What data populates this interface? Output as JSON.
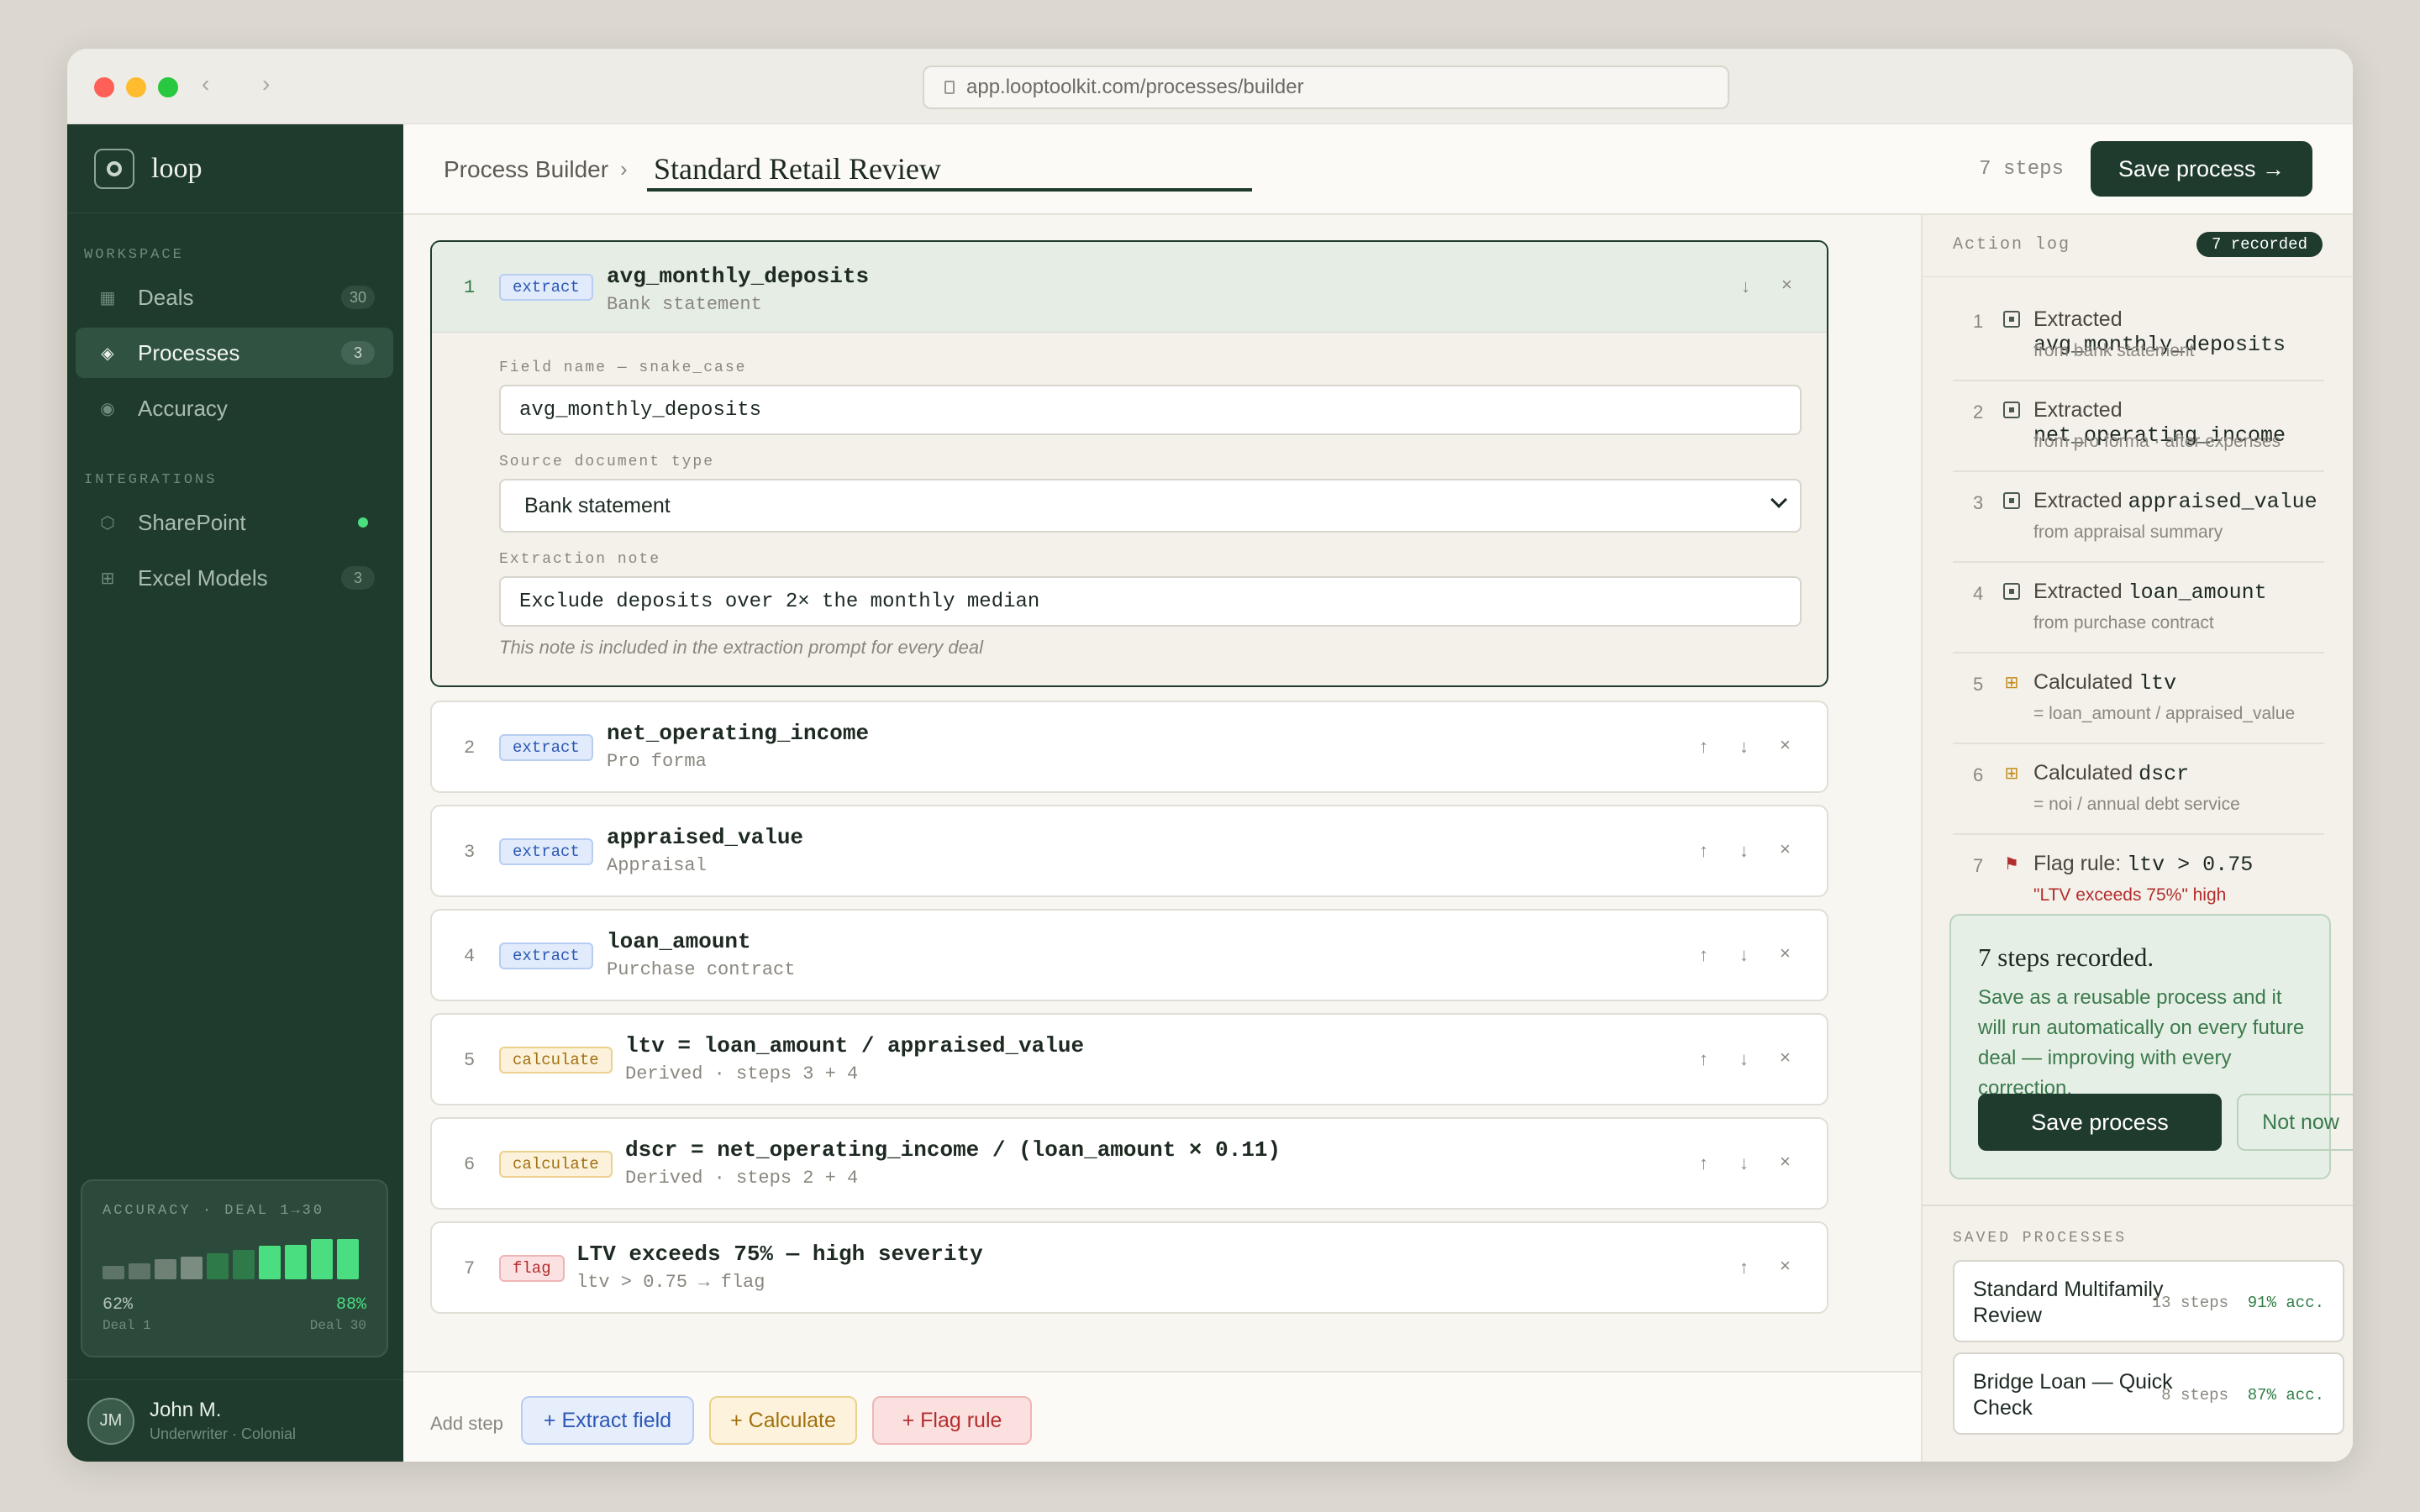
{
  "browser": {
    "url": "app.looptoolkit.com/processes/builder",
    "back_glyph": "‹",
    "forward_glyph": "›"
  },
  "sidebar": {
    "brand": "loop",
    "workspace_label": "WORKSPACE",
    "integrations_label": "INTEGRATIONS",
    "items": [
      {
        "label": "Deals",
        "badge": "30",
        "icon": "grid-icon",
        "glyph": "▦"
      },
      {
        "label": "Processes",
        "badge": "3",
        "icon": "diamond-icon",
        "glyph": "◈"
      },
      {
        "label": "Accuracy",
        "icon": "target-icon",
        "glyph": "◉"
      }
    ],
    "integrations": [
      {
        "label": "SharePoint",
        "icon": "hexagon-icon",
        "glyph": "⬡",
        "status": "connected"
      },
      {
        "label": "Excel Models",
        "badge": "3",
        "icon": "table-icon",
        "glyph": "⊞"
      }
    ],
    "accuracy": {
      "title": "ACCURACY · DEAL 1→30",
      "start_value": "62%",
      "end_value": "88%",
      "start_label": "Deal 1",
      "end_label": "Deal 30",
      "bar_levels": [
        0.28,
        0.34,
        0.42,
        0.48,
        0.56,
        0.62,
        0.72,
        0.74,
        0.86,
        0.86
      ],
      "bar_colors": [
        "#5f7468",
        "#5f7468",
        "#6e8174",
        "#7b8c80",
        "#2f7a49",
        "#2f7a49",
        "#4ade80",
        "#4ade80",
        "#4ade80",
        "#4ade80"
      ]
    },
    "user": {
      "initials": "JM",
      "name": "John M.",
      "role": "Underwriter · Colonial"
    }
  },
  "header": {
    "breadcrumb": "Process Builder",
    "separator": "›",
    "title": "Standard Retail Review",
    "step_count": "7 steps",
    "save_button": "Save process →"
  },
  "steps": [
    {
      "num": "1",
      "type": "extract",
      "name": "avg_monthly_deposits",
      "sub": "Bank statement",
      "expanded": true,
      "form": {
        "field_name_label": "Field name — snake_case",
        "field_name_value": "avg_monthly_deposits",
        "source_label": "Source document type",
        "source_value": "Bank statement",
        "note_label": "Extraction note",
        "note_value": "Exclude deposits over 2× the monthly median",
        "hint": "This note is included in the extraction prompt for every deal"
      }
    },
    {
      "num": "2",
      "type": "extract",
      "name": "net_operating_income",
      "sub": "Pro forma"
    },
    {
      "num": "3",
      "type": "extract",
      "name": "appraised_value",
      "sub": "Appraisal"
    },
    {
      "num": "4",
      "type": "extract",
      "name": "loan_amount",
      "sub": "Purchase contract"
    },
    {
      "num": "5",
      "type": "calculate",
      "name": "ltv = loan_amount / appraised_value",
      "sub": "Derived · steps 3 + 4"
    },
    {
      "num": "6",
      "type": "calculate",
      "name": "dscr = net_operating_income / (loan_amount × 0.11)",
      "sub": "Derived · steps 2 + 4"
    },
    {
      "num": "7",
      "type": "flag",
      "name": "LTV exceeds 75% — high severity",
      "sub": "ltv > 0.75 → flag"
    }
  ],
  "controls": {
    "up": "↑",
    "down": "↓",
    "remove": "×"
  },
  "add_step": {
    "label": "Add step",
    "extract": "+ Extract field",
    "calculate": "+ Calculate",
    "flag": "+ Flag rule"
  },
  "action_log": {
    "title": "Action log",
    "badge": "7 recorded",
    "items": [
      {
        "num": "1",
        "verb": "Extracted",
        "code": "avg_monthly_deposits",
        "sub": "from bank statement",
        "kind": "extract"
      },
      {
        "num": "2",
        "verb": "Extracted",
        "code": "net_operating_income",
        "sub": "from pro forma · after expenses",
        "kind": "extract"
      },
      {
        "num": "3",
        "verb": "Extracted",
        "code": "appraised_value",
        "sub": "from appraisal summary",
        "kind": "extract"
      },
      {
        "num": "4",
        "verb": "Extracted",
        "code": "loan_amount",
        "sub": "from purchase contract",
        "kind": "extract"
      },
      {
        "num": "5",
        "verb": "Calculated",
        "code": "ltv",
        "sub": "= loan_amount / appraised_value",
        "kind": "calculate"
      },
      {
        "num": "6",
        "verb": "Calculated",
        "code": "dscr",
        "sub": "= noi / annual debt service",
        "kind": "calculate"
      },
      {
        "num": "7",
        "verb": "Flag rule:",
        "code": "ltv > 0.75",
        "sub": "\"LTV exceeds 75%\" high",
        "kind": "flag"
      }
    ]
  },
  "save_card": {
    "title": "7 steps recorded.",
    "body": "Save as a reusable process and it will run automatically on every future deal — improving with every correction.",
    "save": "Save process",
    "dismiss": "Not now"
  },
  "saved_processes": {
    "label": "SAVED PROCESSES",
    "items": [
      {
        "name": "Standard Multifamily Review",
        "steps": "13 steps",
        "accuracy": "91% acc."
      },
      {
        "name": "Bridge Loan — Quick Check",
        "steps": "8 steps",
        "accuracy": "87% acc."
      }
    ]
  }
}
